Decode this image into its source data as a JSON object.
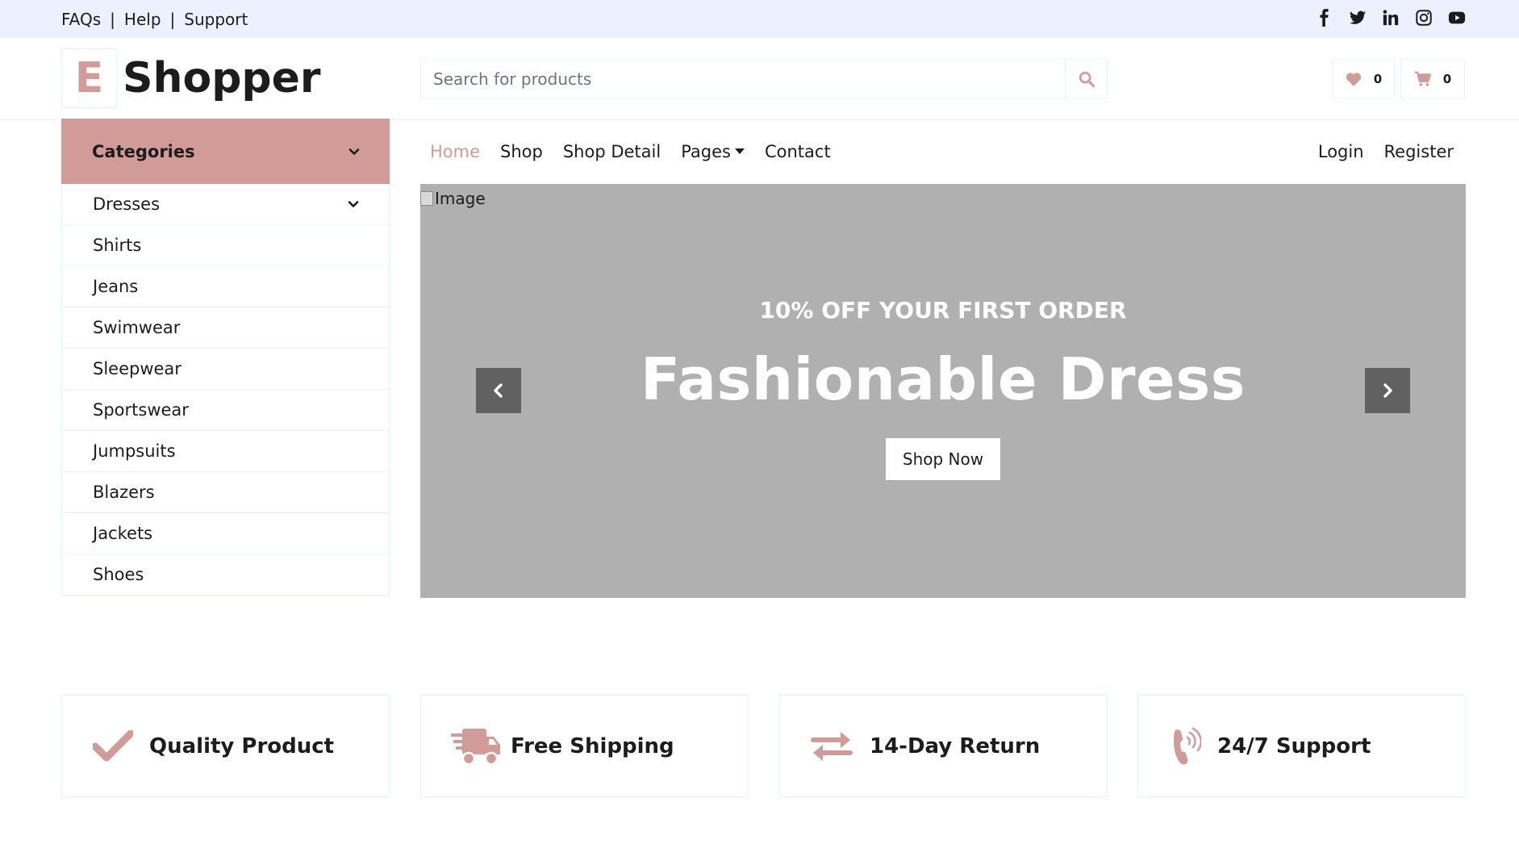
{
  "topbar": {
    "links": [
      "FAQs",
      "Help",
      "Support"
    ],
    "separator": "|",
    "socials": [
      "facebook-icon",
      "twitter-icon",
      "linkedin-icon",
      "instagram-icon",
      "youtube-icon"
    ]
  },
  "header": {
    "logo_letter": "E",
    "logo_text": "Shopper",
    "search_placeholder": "Search for products",
    "wishlist_count": "0",
    "cart_count": "0"
  },
  "categories": {
    "title": "Categories",
    "items": [
      "Dresses",
      "Shirts",
      "Jeans",
      "Swimwear",
      "Sleepwear",
      "Sportswear",
      "Jumpsuits",
      "Blazers",
      "Jackets",
      "Shoes"
    ]
  },
  "nav": {
    "links": [
      "Home",
      "Shop",
      "Shop Detail",
      "Pages",
      "Contact"
    ],
    "active": "Home",
    "right": [
      "Login",
      "Register"
    ]
  },
  "hero": {
    "img_alt": "Image",
    "subtitle": "10% OFF YOUR FIRST ORDER",
    "title": "Fashionable Dress",
    "button": "Shop Now"
  },
  "features": [
    {
      "icon": "check-icon",
      "label": "Quality Product"
    },
    {
      "icon": "shipping-truck-icon",
      "label": "Free Shipping"
    },
    {
      "icon": "exchange-arrows-icon",
      "label": "14-Day Return"
    },
    {
      "icon": "phone-volume-icon",
      "label": "24/7 Support"
    }
  ],
  "colors": {
    "primary": "#d19c97",
    "topbar_bg": "#edf1ff",
    "hero_bg": "#b0b0b0",
    "text": "#1c1c1c"
  }
}
